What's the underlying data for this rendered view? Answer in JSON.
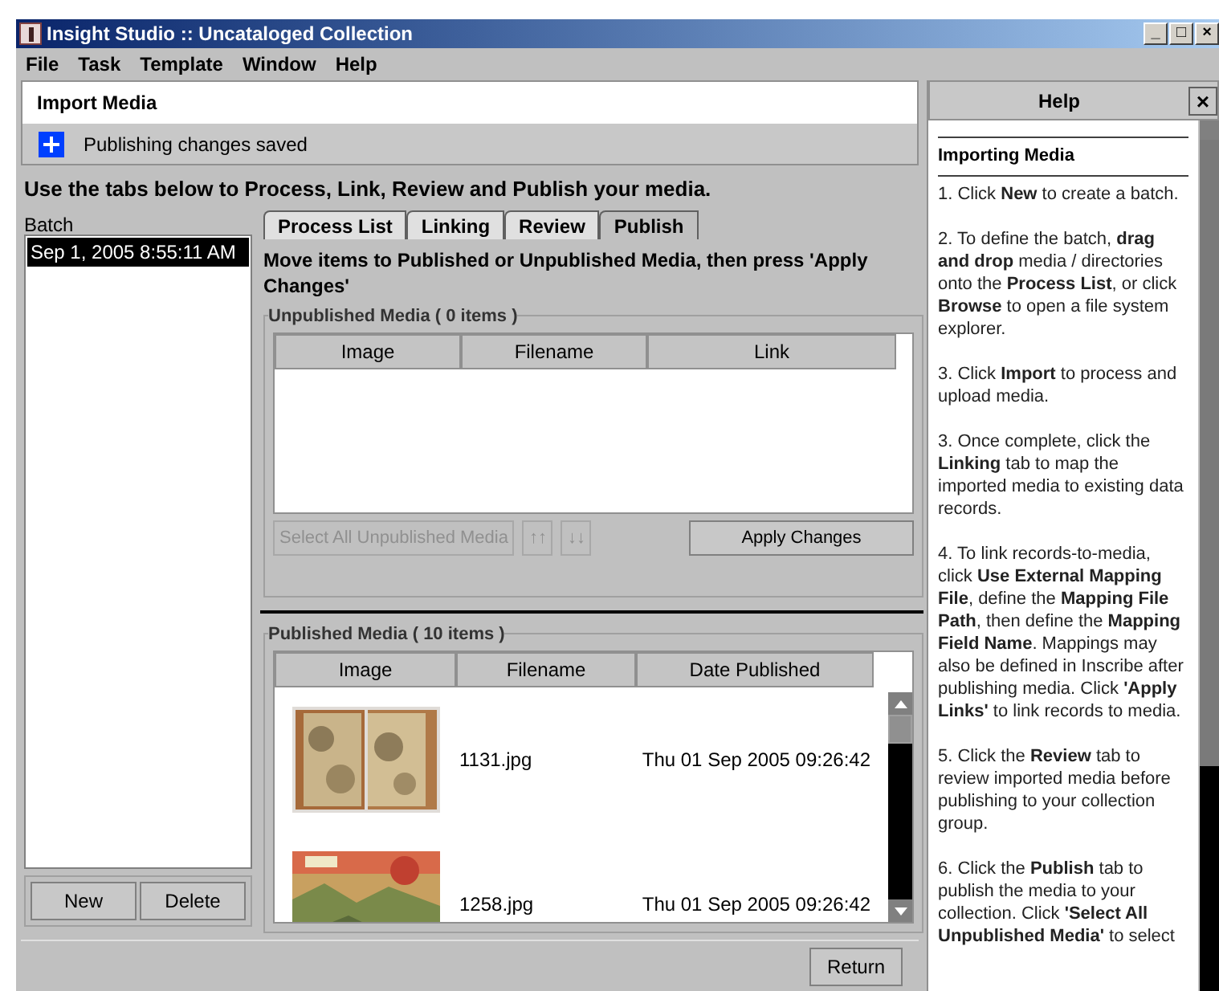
{
  "window": {
    "title": "Insight Studio :: Uncataloged Collection",
    "controls": [
      "_",
      "□",
      "×"
    ]
  },
  "menu": [
    "File",
    "Task",
    "Template",
    "Window",
    "Help"
  ],
  "panel": {
    "title": "Import Media",
    "notice": "Publishing changes saved"
  },
  "instructions": "Use the tabs below to Process, Link, Review and Publish your media.",
  "batch": {
    "label": "Batch",
    "items": [
      {
        "text": "Sep 1, 2005 8:55:11 AM",
        "selected": true
      }
    ],
    "buttons": [
      "New",
      "Delete"
    ]
  },
  "tabs": [
    {
      "label": "Process List",
      "selected": false
    },
    {
      "label": "Linking",
      "selected": false
    },
    {
      "label": "Review",
      "selected": false
    },
    {
      "label": "Publish",
      "selected": true
    }
  ],
  "publish": {
    "heading": "Move items to Published or Unpublished Media, then press 'Apply Changes'",
    "unpublished": {
      "title": "Unpublished Media ( 0 items )",
      "columns": [
        "Image",
        "Filename",
        "Link"
      ]
    },
    "controls": [
      {
        "label": "Select All Unpublished Media",
        "disabled": true
      },
      {
        "label": "↑↑",
        "disabled": true
      },
      {
        "label": "↓↓",
        "disabled": true
      },
      {
        "label": "Apply Changes",
        "disabled": false
      }
    ],
    "published": {
      "title": "Published Media ( 10 items )",
      "columns": [
        "Image",
        "Filename",
        "Date Published"
      ],
      "rows": [
        {
          "filename": "1131.jpg",
          "date": "Thu 01 Sep 2005 09:26:42"
        },
        {
          "filename": "1258.jpg",
          "date": "Thu 01 Sep 2005 09:26:42"
        }
      ]
    }
  },
  "footer": {
    "button": "Return"
  },
  "help": {
    "title": "Help",
    "close": "×",
    "heading": "Importing Media",
    "paragraphs": [
      "1. Click **New** to create a batch.",
      "2. To define the batch, **drag and drop** media / directories onto the **Process List**, or click **Browse** to open a file system explorer.",
      "3. Click **Import** to process and upload media.",
      "3. Once complete, click the **Linking** tab to map the imported media to existing data records.",
      "4. To link records-to-media, click **Use External Mapping File**, define the **Mapping File Path**, then define the **Mapping Field Name**. Mappings may also be defined in Inscribe after publishing media. Click **'Apply Links'** to link records to media.",
      "5. Click the **Review** tab to review imported media before publishing to your collection group.",
      "6. Click the **Publish** tab to publish the media to your collection. Click **'Select All Unpublished Media'** to select"
    ]
  }
}
